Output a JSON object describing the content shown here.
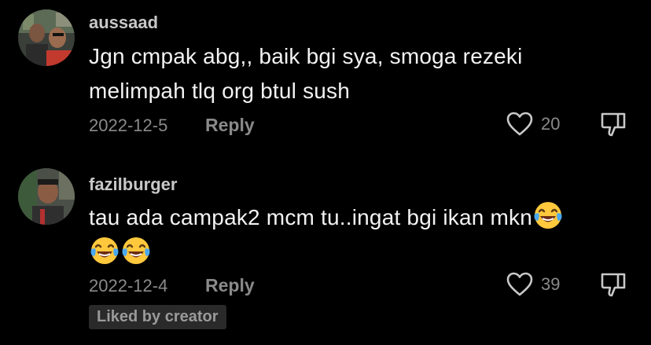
{
  "comments": [
    {
      "username": "aussaad",
      "text_line1": "Jgn cmpak abg,, baik bgi sya, smoga rezeki",
      "text_line2": "melimpah tlq org btul sush",
      "date": "2022-12-5",
      "reply_label": "Reply",
      "like_count": "20",
      "avatar_icon": "avatar-photo-two-men"
    },
    {
      "username": "fazilburger",
      "text_line1": "tau ada campak2 mcm tu..ingat bgi ikan mkn",
      "date": "2022-12-4",
      "reply_label": "Reply",
      "like_count": "39",
      "emoji_icon": "face-with-tears-of-joy",
      "emoji_count_line1": 1,
      "emoji_count_line2": 2,
      "liked_by_creator": "Liked by creator",
      "avatar_icon": "avatar-photo-man"
    }
  ],
  "icons": {
    "like": "heart-outline-icon",
    "dislike": "thumbs-down-outline-icon"
  },
  "colors": {
    "background": "#000000",
    "username": "#c8c8c8",
    "text": "#f2f2f2",
    "meta": "#8a8a8a",
    "badge_bg": "#2a2a2a"
  }
}
